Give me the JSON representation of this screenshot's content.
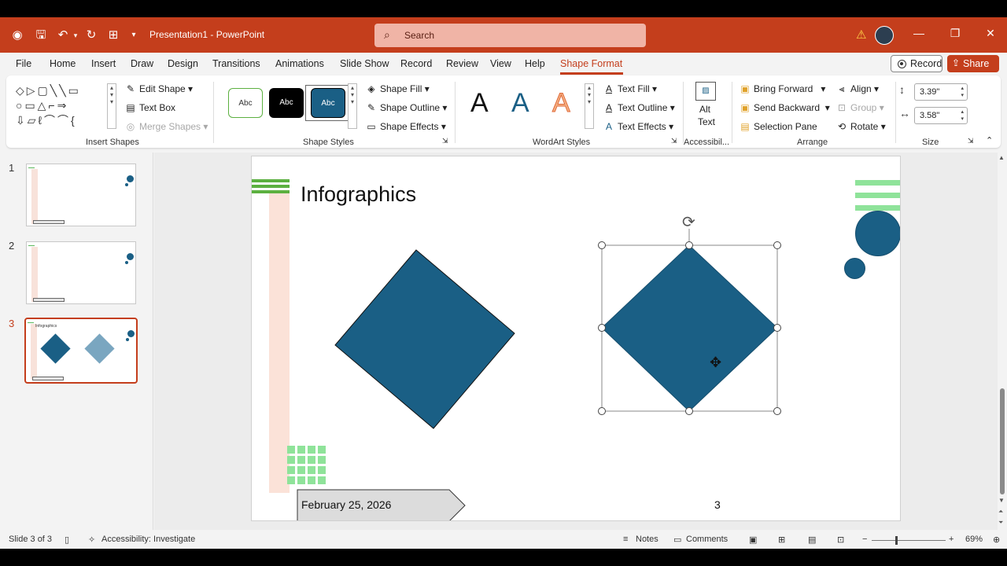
{
  "titlebar": {
    "doc_title": "Presentation1  -  PowerPoint",
    "search_placeholder": "Search",
    "minimize": "—",
    "restore": "❐",
    "close": "✕"
  },
  "menu": {
    "tabs": [
      "File",
      "Home",
      "Insert",
      "Draw",
      "Design",
      "Transitions",
      "Animations",
      "Slide Show",
      "Record",
      "Review",
      "View",
      "Help",
      "Shape Format"
    ],
    "active": "Shape Format",
    "record_label": "Record",
    "share_label": "Share"
  },
  "ribbon": {
    "insert_shapes": {
      "label": "Insert Shapes",
      "edit_shape": "Edit Shape",
      "text_box": "Text Box",
      "merge_shapes": "Merge Shapes"
    },
    "shape_styles": {
      "label": "Shape Styles",
      "presets": [
        "Abc",
        "Abc",
        "Abc"
      ],
      "shape_fill": "Shape Fill",
      "shape_outline": "Shape Outline",
      "shape_effects": "Shape Effects"
    },
    "wordart_styles": {
      "label": "WordArt Styles",
      "letters": [
        "A",
        "A",
        "A"
      ],
      "text_fill": "Text Fill",
      "text_outline": "Text Outline",
      "text_effects": "Text Effects"
    },
    "accessibility": {
      "label": "Accessibil...",
      "alt_text_line1": "Alt",
      "alt_text_line2": "Text"
    },
    "arrange": {
      "label": "Arrange",
      "bring_forward": "Bring Forward",
      "send_backward": "Send Backward",
      "selection_pane": "Selection Pane",
      "align": "Align",
      "group": "Group",
      "rotate": "Rotate"
    },
    "size": {
      "label": "Size",
      "height": "3.39\"",
      "width": "3.58\""
    }
  },
  "thumbnails": [
    {
      "num": "1"
    },
    {
      "num": "2"
    },
    {
      "num": "3",
      "title": "Infographics"
    }
  ],
  "slide": {
    "title": "Infographics",
    "date": "February 25, 2026",
    "page_number": "3"
  },
  "status": {
    "slide_info": "Slide 3 of 3",
    "accessibility": "Accessibility: Investigate",
    "notes": "Notes",
    "comments": "Comments",
    "zoom": "69%"
  },
  "colors": {
    "brand": "#c43e1c",
    "diamond": "#1a5f85",
    "accent_green": "#8fe39a",
    "pink_bar": "#fbe2d8"
  }
}
